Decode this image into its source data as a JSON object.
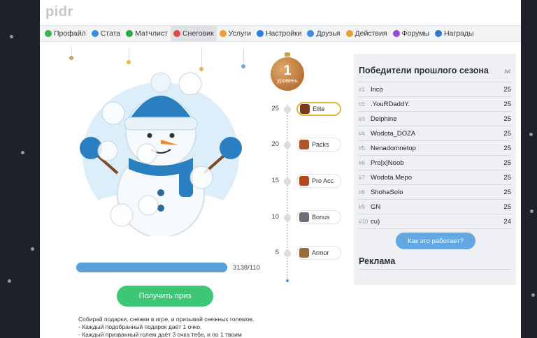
{
  "site": {
    "title": "pidr"
  },
  "nav": {
    "items": [
      {
        "label": "Профайл",
        "icon": "profile-icon",
        "color": "#3cb44b"
      },
      {
        "label": "Стата",
        "icon": "stats-icon",
        "color": "#3b8de0"
      },
      {
        "label": "Матчлист",
        "icon": "matchlist-icon",
        "color": "#2aa84a"
      },
      {
        "label": "Снеговик",
        "icon": "snowman-icon",
        "color": "#e04848",
        "active": true
      },
      {
        "label": "Услуги",
        "icon": "services-icon",
        "color": "#f0a030"
      },
      {
        "label": "Настройки",
        "icon": "settings-icon",
        "color": "#2a7de0"
      },
      {
        "label": "Друзья",
        "icon": "friends-icon",
        "color": "#3a8ee6"
      },
      {
        "label": "Действия",
        "icon": "actions-icon",
        "color": "#e8a030"
      },
      {
        "label": "Форумы",
        "icon": "forums-icon",
        "color": "#9a48d0"
      },
      {
        "label": "Награды",
        "icon": "awards-icon",
        "color": "#2a7ad0"
      }
    ]
  },
  "snowman": {
    "progress_text": "3138/110",
    "progress_fraction": 1.0,
    "prize_button": "Получить приз",
    "description": [
      "Собирай подарки, снежки в игре, и призывай снежных големов.",
      "- Каждый подобранный подарок даёт 1 очко.",
      "- Каждый призванный голем даёт 3 очка тебе, и по 1 твоим"
    ]
  },
  "level": {
    "number": "1",
    "label": "уровень"
  },
  "tiers": [
    {
      "num": "25",
      "label": "Elite",
      "icon": "elite-hero-icon",
      "color": "#7a3a1a",
      "active": true
    },
    {
      "num": "20",
      "label": "Packs",
      "icon": "packs-hero-icon",
      "color": "#b0552a"
    },
    {
      "num": "15",
      "label": "Pro Acc",
      "icon": "chest-icon",
      "color": "#b8461a"
    },
    {
      "num": "10",
      "label": "Bonus",
      "icon": "axe-icon",
      "color": "#6b6f75"
    },
    {
      "num": "5",
      "label": "Armor",
      "icon": "armor-hero-icon",
      "color": "#9a6a3a"
    }
  ],
  "winners": {
    "title": "Победители прошлого сезона",
    "lvl_header": "lvl",
    "rows": [
      {
        "rank": "#1",
        "name": "Inco",
        "score": "25"
      },
      {
        "rank": "#2",
        "name": ".YouRDaddY.",
        "score": "25"
      },
      {
        "rank": "#3",
        "name": "Delphine",
        "score": "25"
      },
      {
        "rank": "#4",
        "name": "Wodota_DOZA",
        "score": "25"
      },
      {
        "rank": "#5",
        "name": "Nenadomnetop",
        "score": "25"
      },
      {
        "rank": "#6",
        "name": "Pro[x]Noob",
        "score": "25"
      },
      {
        "rank": "#7",
        "name": "Wodota.Mepo",
        "score": "25"
      },
      {
        "rank": "#8",
        "name": "ShohaSolo",
        "score": "25"
      },
      {
        "rank": "#9",
        "name": "GN",
        "score": "25"
      },
      {
        "rank": "#10",
        "name": "cu)",
        "score": "24"
      }
    ],
    "how_button": "Как это работает?",
    "ads_title": "Реклама"
  }
}
